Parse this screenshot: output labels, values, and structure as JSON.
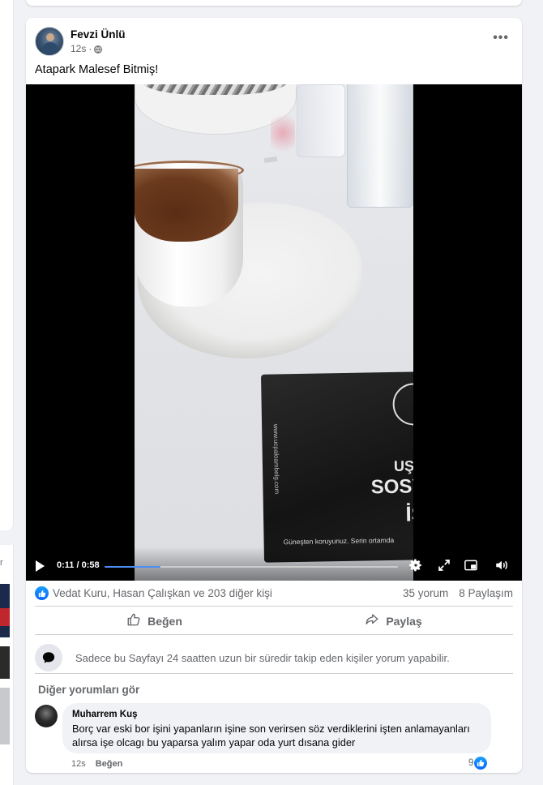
{
  "post": {
    "author": "Fevzi Ünlü",
    "time": "12s",
    "separator": "·",
    "text": "Atapark Malesef Bitmiş!",
    "menu_label": "•••"
  },
  "video": {
    "current_time": "0:11",
    "duration": "0:58",
    "time_display": "0:11 / 0:58",
    "progress_fraction": 0.19,
    "packet_text": {
      "line1": "UŞA",
      "line2": "SOSY",
      "line3": "İS",
      "footer": "Güneşten koruyunuz. Serin ortamda",
      "side": "www.ucpaloambelg.com"
    }
  },
  "reactions": {
    "likers": "Vedat Kuru, Hasan Çalışkan ve 203 diğer kişi",
    "comments": "35 yorum",
    "shares": "8 Paylaşım"
  },
  "actions": {
    "like": "Beğen",
    "share": "Paylaş"
  },
  "restriction": {
    "text": "Sadece bu Sayfayı 24 saatten uzun bir süredir takip eden kişiler yorum yapabilir."
  },
  "comments": {
    "more_label": "Diğer yorumları gör",
    "items": [
      {
        "author": "Muharrem Kuş",
        "text": "Borç var eski bor işini yapanların işine son verirsen söz verdiklerini işten anlamayanları alırsa işe olcagı bu yaparsa yalım yapar oda yurt dısana gider",
        "time": "12s",
        "like_label": "Beğen",
        "reaction_count": "9"
      }
    ]
  },
  "left_panel": {
    "letter": "r"
  },
  "colors": {
    "accent": "#0866ff",
    "background": "#f0f2f5",
    "secondary_text": "#65676b"
  }
}
